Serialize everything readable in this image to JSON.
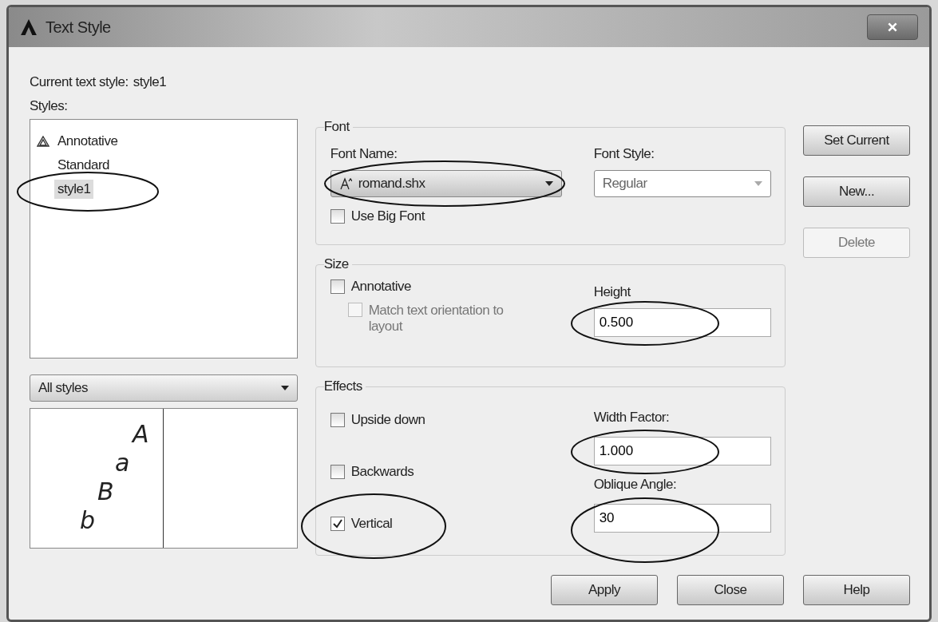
{
  "window": {
    "title": "Text Style"
  },
  "current_style": {
    "label": "Current text style:",
    "value": "style1"
  },
  "styles": {
    "label": "Styles:",
    "items": [
      {
        "label": "Annotative",
        "annotative": true,
        "selected": false
      },
      {
        "label": "Standard",
        "annotative": false,
        "selected": false
      },
      {
        "label": "style1",
        "annotative": false,
        "selected": true
      }
    ]
  },
  "filter": {
    "value": "All styles"
  },
  "preview": {
    "letters": [
      "A",
      "a",
      "B",
      "b"
    ]
  },
  "font": {
    "title": "Font",
    "font_name": {
      "label": "Font Name:",
      "value": "romand.shx"
    },
    "font_style": {
      "label": "Font Style:",
      "value": "Regular",
      "disabled": true
    },
    "use_big_font": {
      "label": "Use Big Font",
      "checked": false
    }
  },
  "size": {
    "title": "Size",
    "annotative": {
      "label": "Annotative",
      "checked": false
    },
    "match": {
      "label": "Match text orientation to layout",
      "checked": false,
      "disabled": true
    },
    "height": {
      "label": "Height",
      "value": "0.500"
    }
  },
  "effects": {
    "title": "Effects",
    "checks": [
      {
        "label": "Upside down",
        "checked": false
      },
      {
        "label": "Backwards",
        "checked": false
      },
      {
        "label": "Vertical",
        "checked": true
      }
    ],
    "width_factor": {
      "label": "Width Factor:",
      "value": "1.000"
    },
    "oblique_angle": {
      "label": "Oblique Angle:",
      "value": "30"
    }
  },
  "side_buttons": [
    {
      "label": "Set Current",
      "disabled": false
    },
    {
      "label": "New...",
      "disabled": false
    },
    {
      "label": "Delete",
      "disabled": true
    }
  ],
  "buttons": [
    {
      "label": "Apply"
    },
    {
      "label": "Close"
    },
    {
      "label": "Help"
    }
  ]
}
